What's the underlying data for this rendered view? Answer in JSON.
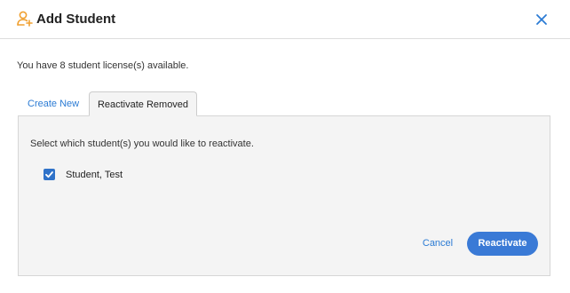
{
  "dialog": {
    "title": "Add Student",
    "license_text": "You have 8 student license(s) available."
  },
  "tabs": [
    {
      "label": "Create New",
      "active": false
    },
    {
      "label": "Reactivate Removed",
      "active": true
    }
  ],
  "panel": {
    "instruction": "Select which student(s) you would like to reactivate.",
    "students": [
      {
        "name": "Student, Test",
        "checked": true
      }
    ]
  },
  "actions": {
    "cancel_label": "Cancel",
    "reactivate_label": "Reactivate"
  },
  "colors": {
    "accent": "#2b7bd4",
    "button_primary": "#3a7ad6",
    "header_icon": "#f0a030",
    "panel_bg": "#f4f4f4"
  },
  "icons": {
    "header": "add-user-icon",
    "close": "close-icon",
    "checkbox": "checkmark-icon"
  }
}
